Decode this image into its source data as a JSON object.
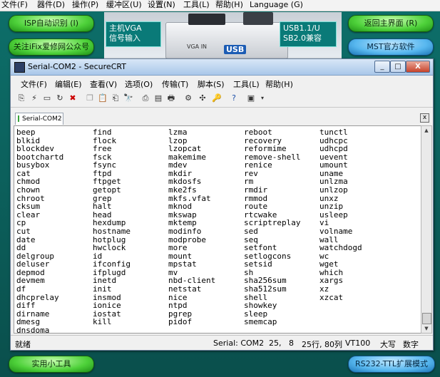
{
  "outer_menu": [
    "文件(F)",
    "器件(D)",
    "操作(P)",
    "缓冲区(U)",
    "设置(N)",
    "工具(L)",
    "帮助(H)",
    "Language (G)"
  ],
  "tool": {
    "isp_button": "ISP自动识别 (I)",
    "ifix_button": "关注iFix爱修网公众号",
    "home_button": "返回主界面 (R)",
    "mst_button": "MST官方软件",
    "tools_button": "实用小工具",
    "rs232_button": "RS232-TTL扩展模式",
    "callout_left": "主机VGA\n信号输入",
    "callout_right": "USB1.1/U\nSB2.0兼容",
    "vga_label": "VGA IN",
    "usb_label": "USB"
  },
  "window": {
    "title": "Serial-COM2 - SecureCRT",
    "min": "_",
    "max": "□",
    "close": "X",
    "menu": [
      "文件(F)",
      "编辑(E)",
      "查看(V)",
      "选项(O)",
      "传输(T)",
      "脚本(S)",
      "工具(L)",
      "帮助(H)"
    ],
    "tab_label": "Serial-COM2",
    "tab_close": "x",
    "terminal_columns": [
      [
        "beep",
        "blkid",
        "blockdev",
        "bootchartd",
        "busybox",
        "cat",
        "chmod",
        "chown",
        "chroot",
        "cksum",
        "clear",
        "cp",
        "cut",
        "date",
        "dd",
        "delgroup",
        "deluser",
        "depmod",
        "devmem",
        "df",
        "dhcprelay",
        "diff",
        "dirname",
        "dmesg",
        "dnsdoma"
      ],
      [
        "find",
        "flock",
        "free",
        "fsck",
        "fsync",
        "ftpd",
        "ftpget",
        "getopt",
        "grep",
        "halt",
        "head",
        "hexdump",
        "hostname",
        "hotplug",
        "hwclock",
        "id",
        "ifconfig",
        "ifplugd",
        "inetd",
        "init",
        "insmod",
        "ionice",
        "iostat",
        "kill"
      ],
      [
        "lzma",
        "lzop",
        "lzopcat",
        "makemime",
        "mdev",
        "mkdir",
        "mkdosfs",
        "mke2fs",
        "mkfs.vfat",
        "mknod",
        "mkswap",
        "mktemp",
        "modinfo",
        "modprobe",
        "more",
        "mount",
        "mpstat",
        "mv",
        "nbd-client",
        "netstat",
        "nice",
        "ntpd",
        "pgrep",
        "pidof"
      ],
      [
        "reboot",
        "recovery",
        "reformime",
        "remove-shell",
        "renice",
        "rev",
        "rm",
        "rmdir",
        "rmmod",
        "route",
        "rtcwake",
        "scriptreplay",
        "sed",
        "seq",
        "setfont",
        "setlogcons",
        "setsid",
        "sh",
        "sha256sum",
        "sha512sum",
        "shell",
        "showkey",
        "sleep",
        "smemcap"
      ],
      [
        "tunctl",
        "udhcpc",
        "udhcpd",
        "uevent",
        "umount",
        "uname",
        "unlzma",
        "unlzop",
        "unxz",
        "unzip",
        "usleep",
        "vi",
        "volname",
        "wall",
        "watchdogd",
        "wc",
        "wget",
        "which",
        "xargs",
        "xz",
        "xzcat"
      ]
    ],
    "status": {
      "ready": "就绪",
      "serial": "Serial: COM2",
      "pos": "25,   8",
      "rows_cols": "25行, 80列",
      "term": "VT100",
      "caps": "大写",
      "num": "数字"
    }
  }
}
